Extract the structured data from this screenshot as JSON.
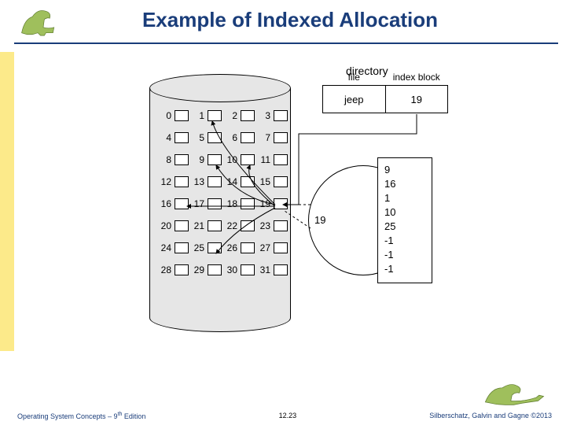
{
  "title": "Example of Indexed Allocation",
  "footer": {
    "left_a": "Operating System Concepts – 9",
    "left_sup": "th",
    "left_b": " Edition",
    "mid": "12.23",
    "right": "Silberschatz, Galvin and Gagne ©2013"
  },
  "diagram": {
    "directory_label": "directory",
    "file_header": "file",
    "file_value": "jeep",
    "index_header": "index block",
    "index_value": "19",
    "disk_index_label": "19",
    "grid_numbers": [
      "0",
      "1",
      "2",
      "3",
      "4",
      "5",
      "6",
      "7",
      "8",
      "9",
      "10",
      "11",
      "12",
      "13",
      "14",
      "15",
      "16",
      "17",
      "18",
      "19",
      "20",
      "21",
      "22",
      "23",
      "24",
      "25",
      "26",
      "27",
      "28",
      "29",
      "30",
      "31"
    ],
    "index_block_entries": [
      "9",
      "16",
      "1",
      "10",
      "25",
      "-1",
      "-1",
      "-1"
    ]
  },
  "chart_data": {
    "type": "table",
    "title": "Indexed Allocation Example",
    "directory": [
      {
        "file": "jeep",
        "index_block": 19
      }
    ],
    "index_block": {
      "block": 19,
      "pointers": [
        9,
        16,
        1,
        10,
        25,
        -1,
        -1,
        -1
      ]
    },
    "disk_blocks_total": 32
  }
}
